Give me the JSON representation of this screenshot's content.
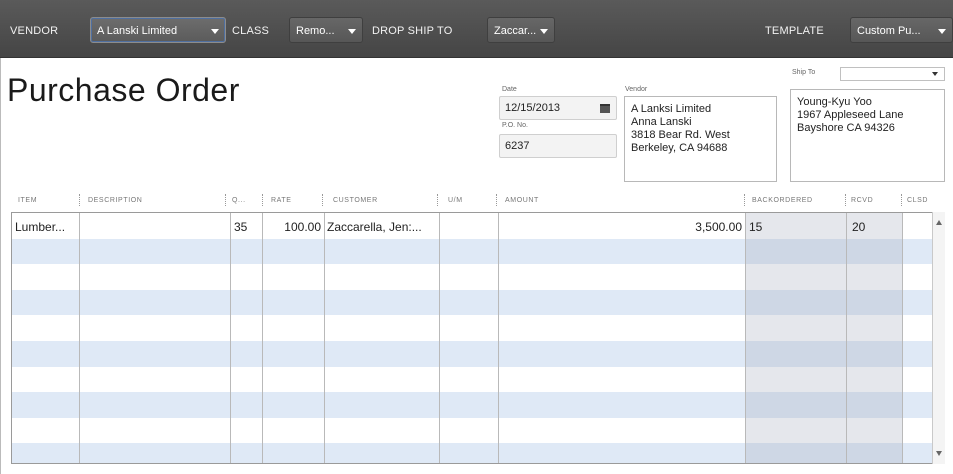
{
  "toolbar": {
    "vendor_label": "VENDOR",
    "vendor_value": "A Lanski Limited",
    "class_label": "CLASS",
    "class_value": "Remo...",
    "drop_ship_label": "DROP SHIP TO",
    "drop_ship_value": "Zaccar...",
    "template_label": "TEMPLATE",
    "template_value": "Custom Pu..."
  },
  "form": {
    "title": "Purchase Order",
    "date_label": "Date",
    "date_value": "12/15/2013",
    "po_label": "P.O. No.",
    "po_value": "6237",
    "vendor_label": "Vendor",
    "vendor_address": [
      "A Lanksi Limited",
      "Anna Lanski",
      "3818 Bear Rd. West",
      "Berkeley, CA 94688"
    ],
    "ship_to_label": "Ship To",
    "ship_to_value": "",
    "ship_to_address": [
      "Young-Kyu Yoo",
      "1967 Appleseed Lane",
      "Bayshore CA 94326"
    ]
  },
  "table": {
    "columns": [
      "ITEM",
      "DESCRIPTION",
      "Q...",
      "RATE",
      "CUSTOMER",
      "U/M",
      "AMOUNT",
      "BACKORDERED",
      "RCVD",
      "CLSD"
    ],
    "rows": [
      {
        "item": "Lumber...",
        "description": "",
        "qty": "35",
        "rate": "100.00",
        "customer": "Zaccarella, Jen:...",
        "um": "",
        "amount": "3,500.00",
        "backordered": "15",
        "rcvd": "20",
        "clsd": ""
      }
    ]
  },
  "colors": {
    "toolbar_bg": "#4e4e4e",
    "row_alt": "#dfe9f6",
    "shaded_columns": "#c8d0dc"
  }
}
